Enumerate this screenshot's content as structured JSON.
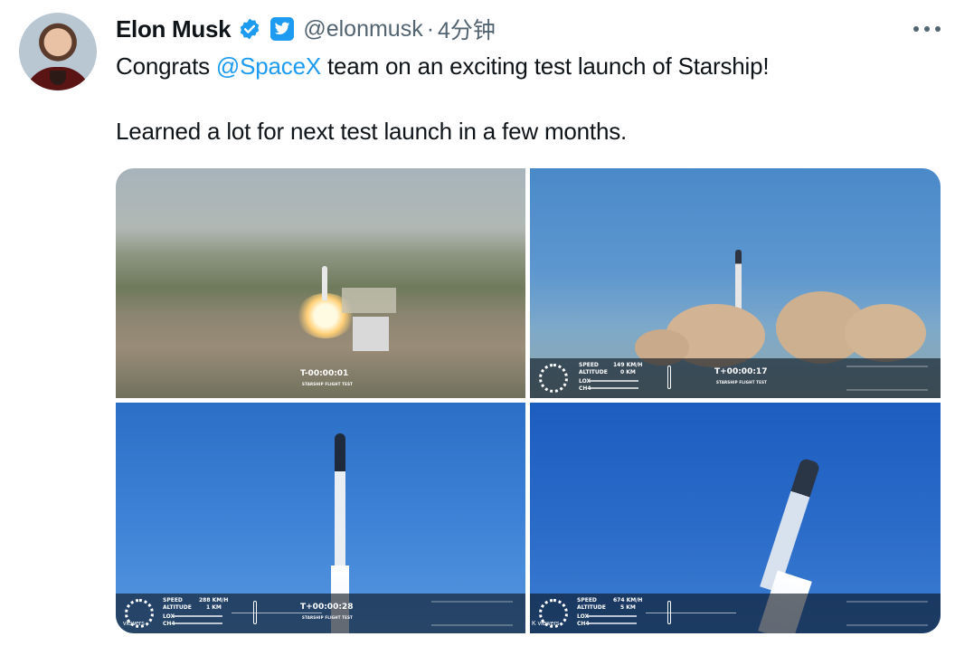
{
  "tweet": {
    "author_name": "Elon Musk",
    "handle": "@elonmusk",
    "separator": "·",
    "time": "4分钟",
    "text_prefix": "Congrats ",
    "mention": "@SpaceX",
    "text_suffix": " team on an exciting test launch of Starship!",
    "text_line2": "Learned a lot for next test launch in a few months."
  },
  "icons": {
    "verified": "verified-badge-icon",
    "affiliate": "twitter-bird-icon",
    "more": "more-horizontal-icon",
    "avatar": "avatar"
  },
  "colors": {
    "link": "#1d9bf0",
    "verified": "#1d9bf0",
    "muted": "#536471",
    "text": "#0f1419"
  },
  "media": [
    {
      "clock": "T-00:00:01",
      "caption": "STARSHIP FLIGHT TEST"
    },
    {
      "clock": "T+00:00:17",
      "caption": "STARSHIP FLIGHT TEST",
      "speed_label": "SPEED",
      "speed_value": "149 KM/H",
      "altitude_label": "ALTITUDE",
      "altitude_value": "0 KM",
      "lox_label": "LOX",
      "ch4_label": "CH4"
    },
    {
      "clock": "T+00:00:28",
      "caption": "STARSHIP FLIGHT TEST",
      "speed_label": "SPEED",
      "speed_value": "288 KM/H",
      "altitude_label": "ALTITUDE",
      "altitude_value": "1 KM",
      "lox_label": "LOX",
      "ch4_label": "CH4",
      "viewers": "viewers"
    },
    {
      "speed_label": "SPEED",
      "speed_value": "674 KM/H",
      "altitude_label": "ALTITUDE",
      "altitude_value": "5 KM",
      "lox_label": "LOX",
      "ch4_label": "CH4",
      "viewers": "K viewers"
    }
  ]
}
